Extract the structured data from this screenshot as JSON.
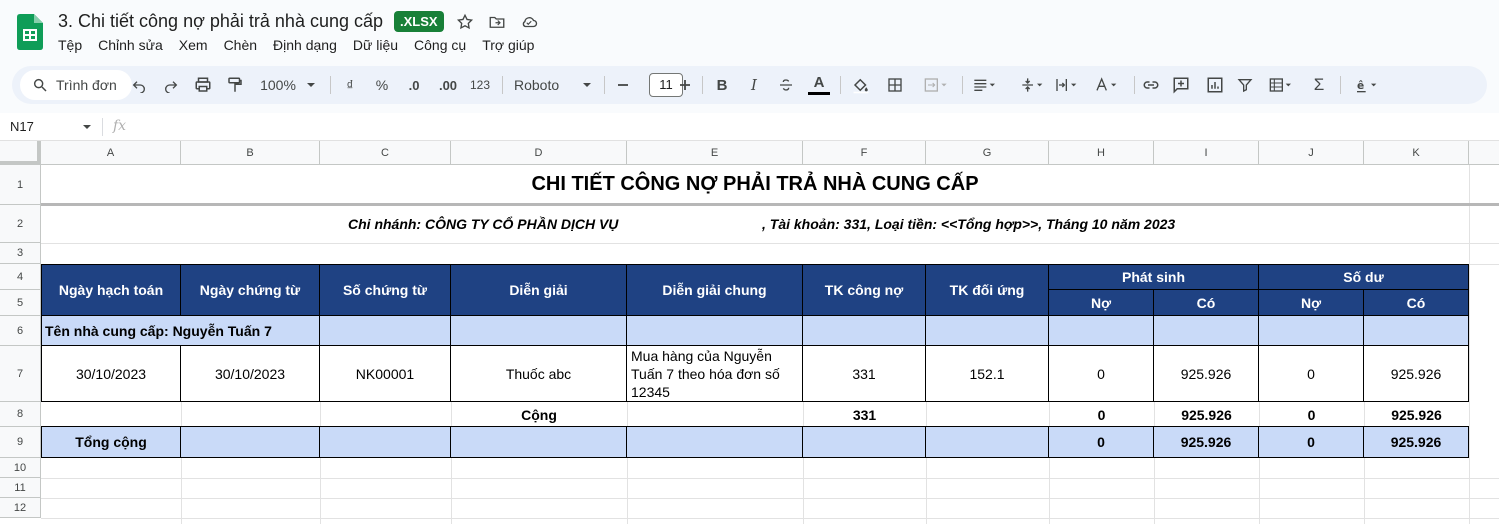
{
  "doc": {
    "title": "3. Chi tiết công nợ phải trả nhà cung cấp",
    "badge": ".XLSX",
    "menu": [
      "Tệp",
      "Chỉnh sửa",
      "Xem",
      "Chèn",
      "Định dạng",
      "Dữ liệu",
      "Công cụ",
      "Trợ giúp"
    ]
  },
  "toolbar": {
    "search_label": "Trình đơn",
    "zoom": "100%",
    "currency": "₫",
    "percent": "%",
    "dec_less": ".0",
    "dec_more": ".00",
    "number_format": "123",
    "font": "Roboto",
    "font_size": "11"
  },
  "formula": {
    "cell_ref": "N17",
    "fx": "fx"
  },
  "columns": [
    "A",
    "B",
    "C",
    "D",
    "E",
    "F",
    "G",
    "H",
    "I",
    "J",
    "K"
  ],
  "rows": [
    "1",
    "2",
    "3",
    "4",
    "5",
    "6",
    "7",
    "8",
    "9",
    "10",
    "11",
    "12"
  ],
  "sheet": {
    "title": "CHI TIẾT CÔNG NỢ PHẢI TRẢ NHÀ CUNG CẤP",
    "subtitle_left": "Chi nhánh: CÔNG TY CỔ PHẦN DỊCH VỤ",
    "subtitle_right": ", Tài khoản: 331, Loại tiền: <<Tổng hợp>>, Tháng 10 năm 2023",
    "headers": {
      "ngay_hach_toan": "Ngày hạch toán",
      "ngay_chung_tu": "Ngày chứng từ",
      "so_chung_tu": "Số chứng từ",
      "dien_giai": "Diễn giải",
      "dien_giai_chung": "Diễn giải chung",
      "tk_cong_no": "TK công nợ",
      "tk_doi_ung": "TK đối ứng",
      "phat_sinh": "Phát sinh",
      "so_du": "Số dư",
      "no": "Nợ",
      "co": "Có"
    },
    "supplier_row": "Tên nhà cung cấp: Nguyễn Tuấn 7",
    "detail": {
      "ngay_hach_toan": "30/10/2023",
      "ngay_chung_tu": "30/10/2023",
      "so_chung_tu": "NK00001",
      "dien_giai": "Thuốc abc",
      "dien_giai_chung": "Mua hàng của Nguyễn Tuấn 7 theo hóa đơn số 12345",
      "tk_cong_no": "331",
      "tk_doi_ung": "152.1",
      "ps_no": "0",
      "ps_co": "925.926",
      "sd_no": "0",
      "sd_co": "925.926"
    },
    "subtotal": {
      "label": "Cộng",
      "tk_cong_no": "331",
      "ps_no": "0",
      "ps_co": "925.926",
      "sd_no": "0",
      "sd_co": "925.926"
    },
    "total": {
      "label": "Tổng cộng",
      "ps_no": "0",
      "ps_co": "925.926",
      "sd_no": "0",
      "sd_co": "925.926"
    }
  },
  "colors": {
    "header_bg": "#1f4283",
    "light_blue": "#c9daf8",
    "badge_green": "#188038"
  }
}
